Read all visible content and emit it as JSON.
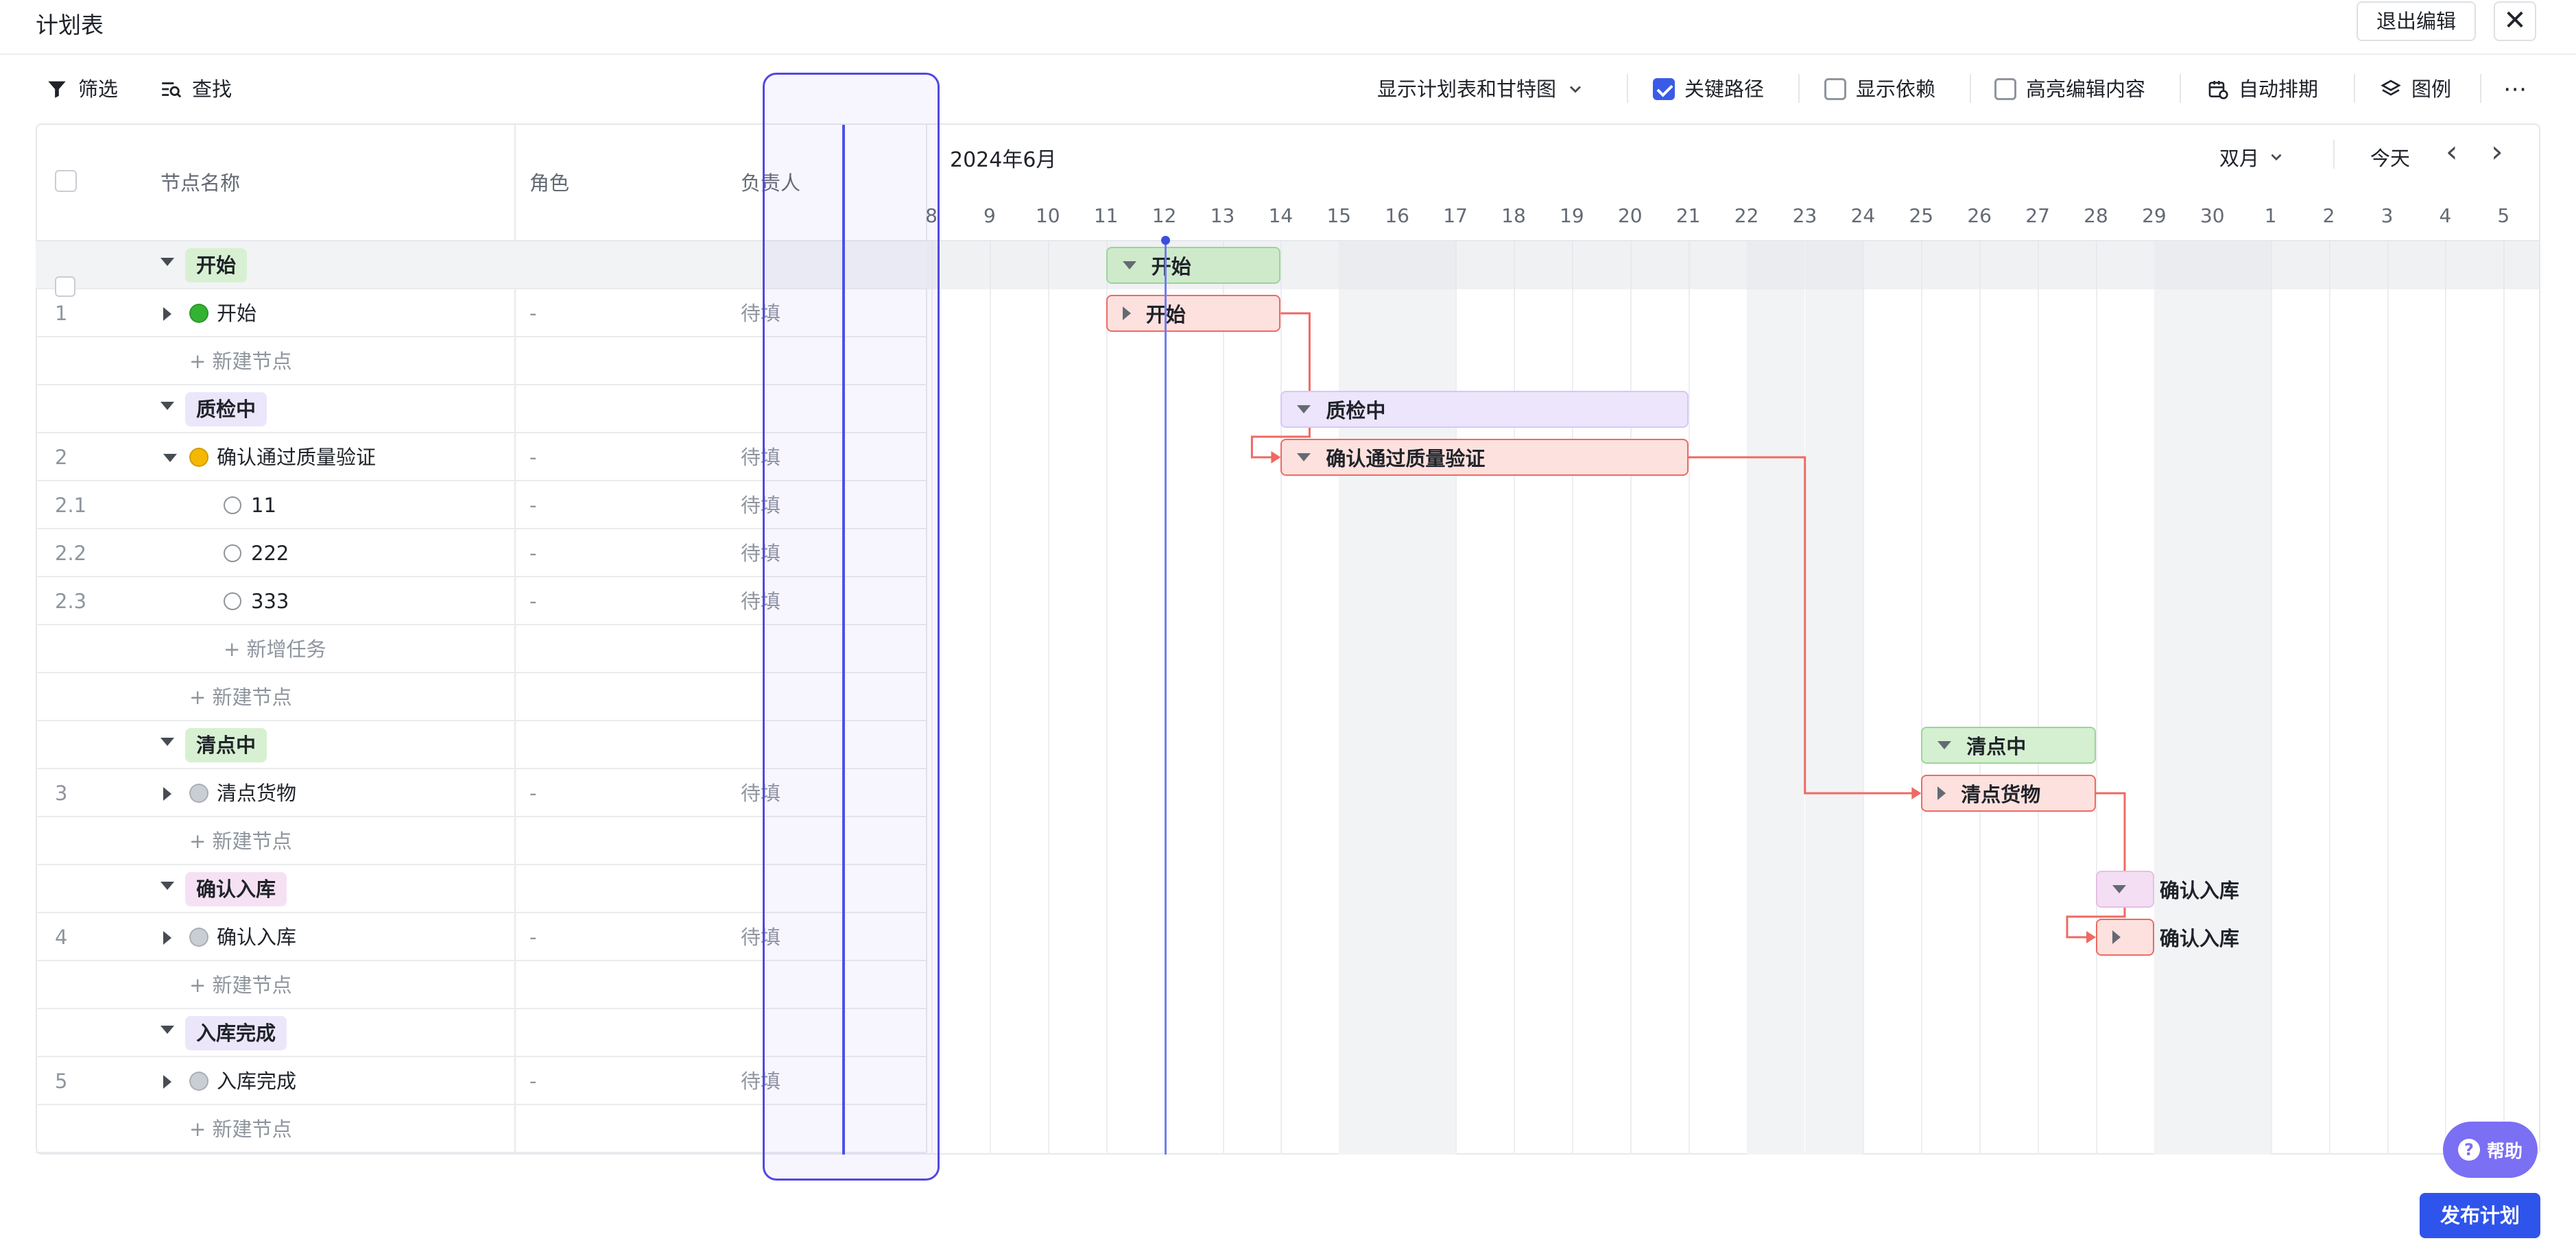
{
  "header": {
    "title": "计划表",
    "exit_label": "退出编辑",
    "close_glyph": "✕"
  },
  "toolbar": {
    "filter_label": "筛选",
    "find_label": "查找",
    "view_select": "显示计划表和甘特图",
    "critical_path_label": "关键路径",
    "critical_path_checked": true,
    "show_dependency_label": "显示依赖",
    "highlight_label": "高亮编辑内容",
    "auto_schedule_label": "自动排期",
    "legend_label": "图例",
    "more_glyph": "⋯"
  },
  "table": {
    "columns": {
      "name": "节点名称",
      "role": "角色",
      "owner": "负责人"
    }
  },
  "gantt": {
    "month_label": "2024年6月",
    "scale_label": "双月",
    "today_label": "今天",
    "prev_glyph": "‹",
    "next_glyph": "›",
    "days": [
      "8",
      "9",
      "10",
      "11",
      "12",
      "13",
      "14",
      "15",
      "16",
      "17",
      "18",
      "19",
      "20",
      "21",
      "22",
      "23",
      "24",
      "25",
      "26",
      "27",
      "28",
      "29",
      "30",
      "1",
      "2",
      "3",
      "4",
      "5"
    ]
  },
  "rows": [
    {
      "type": "group",
      "label": "开始",
      "tag_color": "#d7f0d2",
      "bar_color": "#cfeacb",
      "bar_border": "#9cd49a",
      "bar_label": "开始"
    },
    {
      "type": "node",
      "num": "1",
      "label": "开始",
      "status_color": "#34b233",
      "role": "-",
      "owner": "待填",
      "bar_label": "开始"
    },
    {
      "type": "add",
      "label": "+ 新建节点"
    },
    {
      "type": "group",
      "label": "质检中",
      "tag_color": "#ece6fb",
      "bar_color": "#ece5fb",
      "bar_border": "#d6c8f5",
      "bar_label": "质检中"
    },
    {
      "type": "node",
      "num": "2",
      "label": "确认通过质量验证",
      "status_color": "#f5b800",
      "role": "-",
      "owner": "待填",
      "bar_label": "确认通过质量验证",
      "expanded": true
    },
    {
      "type": "task",
      "num": "2.1",
      "label": "11",
      "role": "-",
      "owner": "待填"
    },
    {
      "type": "task",
      "num": "2.2",
      "label": "222",
      "role": "-",
      "owner": "待填"
    },
    {
      "type": "task",
      "num": "2.3",
      "label": "333",
      "role": "-",
      "owner": "待填"
    },
    {
      "type": "addtask",
      "label": "+ 新增任务"
    },
    {
      "type": "add",
      "label": "+ 新建节点"
    },
    {
      "type": "group",
      "label": "清点中",
      "tag_color": "#d7f0d2",
      "bar_color": "#d5efd1",
      "bar_border": "#9cd49a",
      "bar_label": "清点中"
    },
    {
      "type": "node",
      "num": "3",
      "label": "清点货物",
      "status_color": "#c9cdd4",
      "role": "-",
      "owner": "待填",
      "bar_label": "清点货物"
    },
    {
      "type": "add",
      "label": "+ 新建节点"
    },
    {
      "type": "group",
      "label": "确认入库",
      "tag_color": "#f6e1f4",
      "bar_color": "#f4def3",
      "bar_border": "#e6bfe3",
      "bar_label": "确认入库"
    },
    {
      "type": "node",
      "num": "4",
      "label": "确认入库",
      "status_color": "#c9cdd4",
      "role": "-",
      "owner": "待填",
      "bar_label": "确认入库"
    },
    {
      "type": "add",
      "label": "+ 新建节点"
    },
    {
      "type": "group",
      "label": "入库完成",
      "tag_color": "#ece6fb",
      "bar_color": "#ece5fb",
      "bar_border": "#d6c8f5",
      "bar_label": ""
    },
    {
      "type": "node",
      "num": "5",
      "label": "入库完成",
      "status_color": "#c9cdd4",
      "role": "-",
      "owner": "待填",
      "bar_label": ""
    },
    {
      "type": "add",
      "label": "+ 新建节点"
    }
  ],
  "footer": {
    "help_label": "帮助",
    "help_glyph": "?",
    "publish_label": "发布计划"
  },
  "colors": {
    "accent": "#2f54eb",
    "critical": "#ee6a62",
    "today_line": "#6f7df0"
  }
}
